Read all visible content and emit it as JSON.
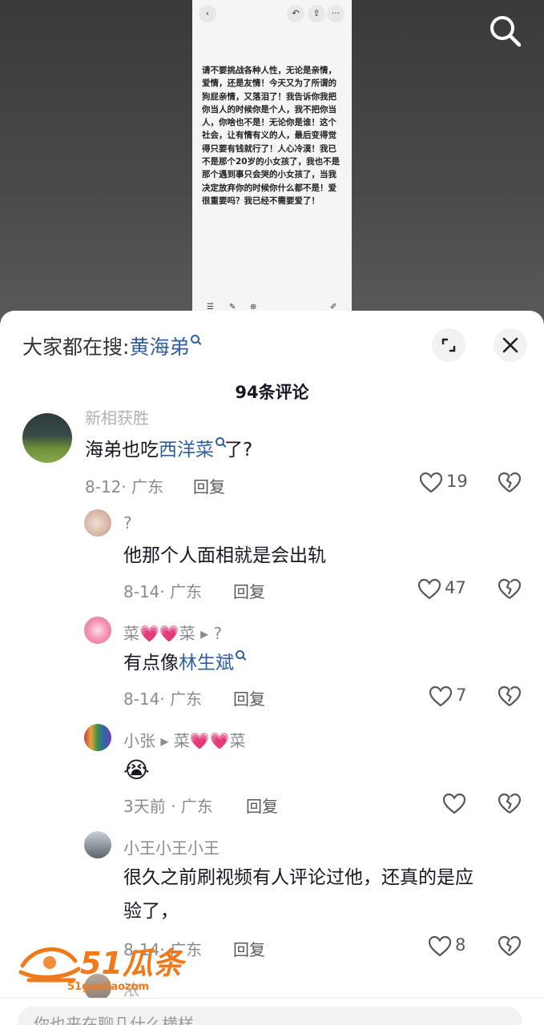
{
  "video": {
    "phone_text": "请不要挑战各种人性，无论是亲情，爱情，还是友情！今天又为了所谓的狗屁亲情，又落泪了！我告诉你我把你当人的时候你是个人，我不把你当人，你啥也不是！无论你是谁！这个社会，让有情有义的人，最后变得觉得只要有钱就行了！人心冷漠！我已不是那个20岁的小女孩了，我也不是那个遇到事只会哭的小女孩了，当我决定放弃你的时候你什么都不是！爱很重要吗？我已经不需要爱了！"
  },
  "sheet": {
    "search_prefix": "大家都在搜:",
    "search_keyword": "黄海弟",
    "comment_count": "94条评论"
  },
  "comments": [
    {
      "username": "新相获胜",
      "text_before": "海弟也吃",
      "keyword": "西洋菜",
      "text_after": "了?",
      "meta": "8-12· 广东",
      "reply": "回复",
      "likes": "19"
    },
    {
      "username": "?",
      "text": "他那个人面相就是会出轨",
      "meta": "8-14· 广东",
      "reply": "回复",
      "likes": "47"
    },
    {
      "username": "菜💗💗菜 ▸ ?",
      "text_before": "有点像",
      "keyword": "林生斌",
      "meta": "8-14· 广东",
      "reply": "回复",
      "likes": "7"
    },
    {
      "username": "小张 ▸ 菜💗💗菜",
      "text": "😭",
      "meta": "3天前 · 广东",
      "reply": "回复",
      "likes": ""
    },
    {
      "username": "小王小王小王",
      "text_line1": "很久之前刷视频有人评论过他，还真的是应",
      "text_line2": "验了，",
      "meta": "8-14· 广东",
      "reply": "回复",
      "likes": "8"
    },
    {
      "username": "浓"
    }
  ],
  "watermark": {
    "main": "51瓜条",
    "sub": "51gualiaozom"
  },
  "input": {
    "placeholder": "你也来在聊几什么横样"
  },
  "colors": {
    "keyword": "#2f5f9e",
    "secondary": "#8a8b91",
    "primary": "#161823"
  }
}
